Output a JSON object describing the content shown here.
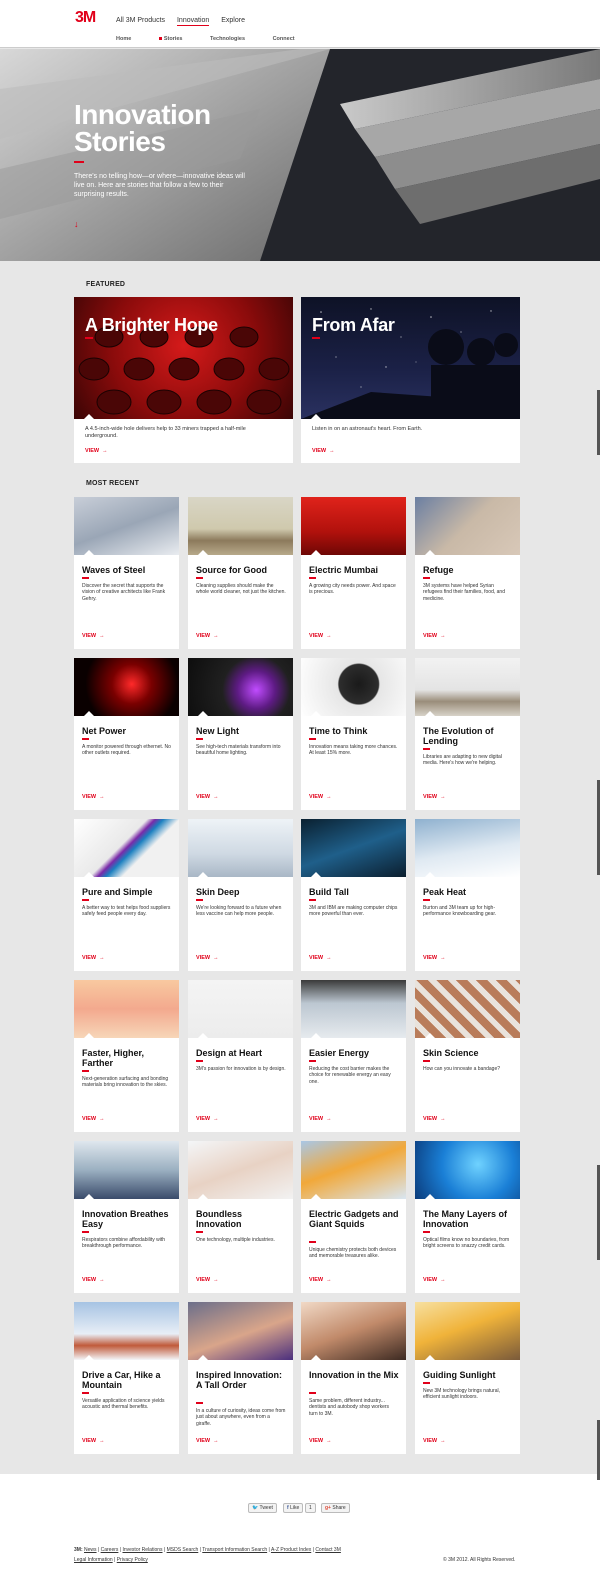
{
  "header": {
    "logo": "3M",
    "nav": [
      {
        "label": "All 3M Products",
        "active": false
      },
      {
        "label": "Innovation",
        "active": true
      },
      {
        "label": "Explore",
        "active": false
      }
    ],
    "subnav": [
      {
        "label": "Home",
        "active": false
      },
      {
        "label": "Stories",
        "active": true
      },
      {
        "label": "Technologies",
        "active": false
      },
      {
        "label": "Connect",
        "active": false
      }
    ]
  },
  "hero": {
    "title_line1": "Innovation",
    "title_line2": "Stories",
    "text": "There's no telling how—or where—innovative ideas will live on. Here are stories that follow a few to their surprising results.",
    "arrow": "↓"
  },
  "featured": {
    "label": "FEATURED",
    "items": [
      {
        "title": "A Brighter Hope",
        "desc": "A 4.5-inch-wide hole delivers help to 33 miners trapped a half-mile underground.",
        "view": "VIEW"
      },
      {
        "title": "From Afar",
        "desc": "Listen in on an astronaut's heart. From Earth.",
        "view": "VIEW"
      }
    ]
  },
  "recent": {
    "label": "MOST RECENT",
    "items": [
      {
        "title": "Waves of Steel",
        "desc": "Discover the secret that supports the vision of creative architects like Frank Gehry.",
        "view": "VIEW"
      },
      {
        "title": "Source for Good",
        "desc": "Cleaning supplies should make the whole world cleaner, not just the kitchen.",
        "view": "VIEW"
      },
      {
        "title": "Electric Mumbai",
        "desc": "A growing city needs power. And space is precious.",
        "view": "VIEW"
      },
      {
        "title": "Refuge",
        "desc": "3M systems have helped Syrian refugees find their families, food, and medicine.",
        "view": "VIEW"
      },
      {
        "title": "Net Power",
        "desc": "A monitor powered through ethernet. No other outlets required.",
        "view": "VIEW"
      },
      {
        "title": "New Light",
        "desc": "See high-tech materials transform into beautiful home lighting.",
        "view": "VIEW"
      },
      {
        "title": "Time to Think",
        "desc": "Innovation means taking more chances. At least 15% more.",
        "view": "VIEW"
      },
      {
        "title": "The Evolution of Lending",
        "desc": "Libraries are adapting to new digital media. Here's how we're helping.",
        "view": "VIEW"
      },
      {
        "title": "Pure and Simple",
        "desc": "A better way to test helps food suppliers safely feed people every day.",
        "view": "VIEW"
      },
      {
        "title": "Skin Deep",
        "desc": "We're looking forward to a future when less vaccine can help more people.",
        "view": "VIEW"
      },
      {
        "title": "Build Tall",
        "desc": "3M and IBM are making computer chips more powerful than ever.",
        "view": "VIEW"
      },
      {
        "title": "Peak Heat",
        "desc": "Burton and 3M team up for high-performance knowboarding gear.",
        "view": "VIEW"
      },
      {
        "title": "Faster, Higher, Farther",
        "desc": "Next-generation surfacing and bonding materials bring innovation to the skies.",
        "view": "VIEW"
      },
      {
        "title": "Design at Heart",
        "desc": "3M's passion for innovation is by design.",
        "view": "VIEW"
      },
      {
        "title": "Easier Energy",
        "desc": "Reducing the cost barrier makes the choice for renewable energy an easy one.",
        "view": "VIEW"
      },
      {
        "title": "Skin Science",
        "desc": "How can you innovate a bandage?",
        "view": "VIEW"
      },
      {
        "title": "Innovation Breathes Easy",
        "desc": "Respirators combine affordability with breakthrough performance.",
        "view": "VIEW"
      },
      {
        "title": "Boundless Innovation",
        "desc": "One technology, multiple industries.",
        "view": "VIEW"
      },
      {
        "title": "Electric Gadgets and Giant Squids",
        "desc": "Unique chemistry protects both devices and memorable treasures alike.",
        "view": "VIEW"
      },
      {
        "title": "The Many Layers of Innovation",
        "desc": "Optical films know no boundaries, from bright screens to snazzy credit cards.",
        "view": "VIEW"
      },
      {
        "title": "Drive a Car, Hike a Mountain",
        "desc": "Versatile application of science yields acoustic and thermal benefits.",
        "view": "VIEW"
      },
      {
        "title": "Inspired Innovation: A Tall Order",
        "desc": "In a culture of curiosity, ideas come from just about anywhere, even from a giraffe.",
        "view": "VIEW"
      },
      {
        "title": "Innovation in the Mix",
        "desc": "Same problem, different industry... dentists and autobody shop workers turn to 3M.",
        "view": "VIEW"
      },
      {
        "title": "Guiding Sunlight",
        "desc": "New 3M technology brings natural, efficient sunlight indoors.",
        "view": "VIEW"
      }
    ]
  },
  "social": {
    "tweet": "Tweet",
    "like": "Like",
    "like_count": "1",
    "share": "Share"
  },
  "footer": {
    "prefix": "3M:",
    "links": [
      "News",
      "Careers",
      "Investor Relations",
      "MSDS Search",
      "Transport Information Search",
      "A-Z Product Index",
      "Contact 3M"
    ],
    "links2": [
      "Legal Information",
      "Privacy Policy"
    ],
    "copyright": "© 3M 2012. All Rights Reserved."
  }
}
